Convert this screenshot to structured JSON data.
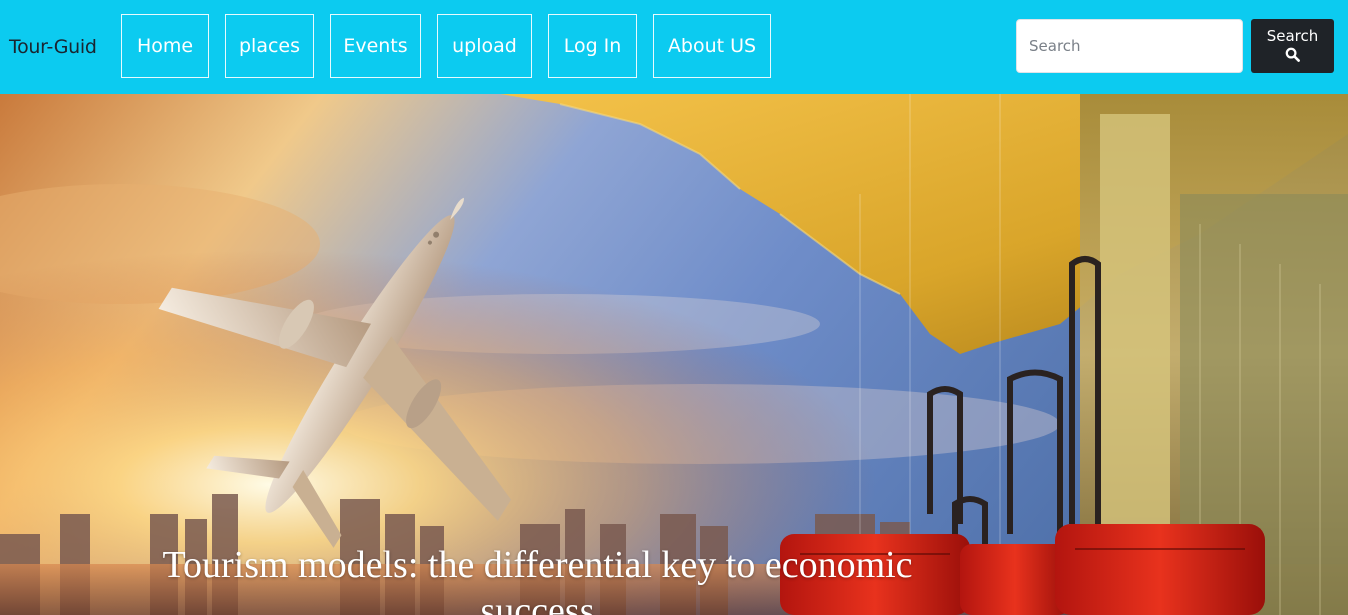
{
  "brand": "Tour-Guid",
  "nav": {
    "home": "Home",
    "places": "places",
    "events": "Events",
    "upload": "upload",
    "login": "Log In",
    "about": "About US"
  },
  "search": {
    "placeholder": "Search",
    "button_label": "Search",
    "icon": "search-icon"
  },
  "hero": {
    "image": "airplane taking off over city skyline at sunset with red suitcases at airport window",
    "caption": "Tourism models: the differential key to economic success"
  },
  "colors": {
    "navbar": "#0ccbf0",
    "search_button": "#1f2328",
    "nav_text": "#ffffff",
    "brand_text": "#1a2530"
  }
}
